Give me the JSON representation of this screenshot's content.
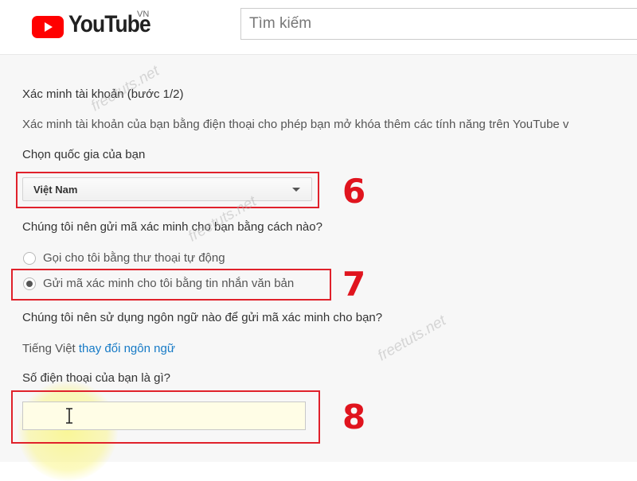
{
  "header": {
    "logo_text": "YouTube",
    "logo_region": "VN",
    "search_placeholder": "Tìm kiếm"
  },
  "verify": {
    "title": "Xác minh tài khoản (bước 1/2)",
    "description": "Xác minh tài khoản của bạn bằng điện thoại cho phép bạn mở khóa thêm các tính năng trên YouTube v",
    "country_label": "Chọn quốc gia của bạn",
    "country_selected": "Việt Nam",
    "method_question": "Chúng tôi nên gửi mã xác minh cho bạn bằng cách nào?",
    "method_options": [
      {
        "label": "Gọi cho tôi bằng thư thoại tự động",
        "checked": false
      },
      {
        "label": "Gửi mã xác minh cho tôi bằng tin nhắn văn bản",
        "checked": true
      }
    ],
    "language_question": "Chúng tôi nên sử dụng ngôn ngữ nào để gửi mã xác minh cho bạn?",
    "language_current": "Tiếng Việt",
    "language_change_link": "thay đổi ngôn ngữ",
    "phone_label": "Số điện thoại của bạn là gì?",
    "phone_value": ""
  },
  "annotations": {
    "step_6": "6",
    "step_7": "7",
    "step_8": "8",
    "watermark": "freetuts.net",
    "highlight_color": "#e0212b"
  }
}
